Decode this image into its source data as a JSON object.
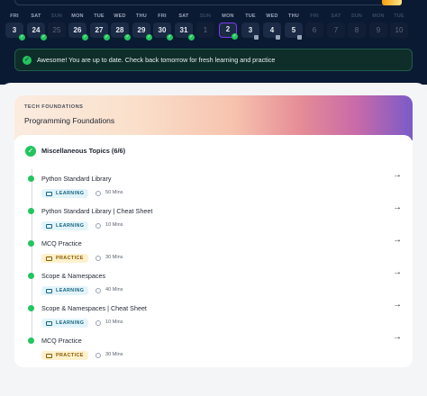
{
  "days": [
    {
      "name": "FRI",
      "num": "3",
      "state": "done"
    },
    {
      "name": "SAT",
      "num": "24",
      "state": "done"
    },
    {
      "name": "SUN",
      "num": "25",
      "state": "weekend"
    },
    {
      "name": "MON",
      "num": "26",
      "state": "done"
    },
    {
      "name": "TUE",
      "num": "27",
      "state": "done"
    },
    {
      "name": "WED",
      "num": "28",
      "state": "done"
    },
    {
      "name": "THU",
      "num": "29",
      "state": "done"
    },
    {
      "name": "FRI",
      "num": "30",
      "state": "done"
    },
    {
      "name": "SAT",
      "num": "31",
      "state": "done"
    },
    {
      "name": "SUN",
      "num": "1",
      "state": "weekend"
    },
    {
      "name": "MON",
      "num": "2",
      "state": "today"
    },
    {
      "name": "TUE",
      "num": "3",
      "state": "locked"
    },
    {
      "name": "WED",
      "num": "4",
      "state": "locked"
    },
    {
      "name": "THU",
      "num": "5",
      "state": "locked"
    },
    {
      "name": "FRI",
      "num": "6",
      "state": "future"
    },
    {
      "name": "SAT",
      "num": "7",
      "state": "future"
    },
    {
      "name": "SUN",
      "num": "8",
      "state": "future"
    },
    {
      "name": "MON",
      "num": "9",
      "state": "future"
    },
    {
      "name": "TUE",
      "num": "10",
      "state": "future"
    }
  ],
  "banner": {
    "check": "✓",
    "message": "Awesome! You are up to date. Check back tomorrow for fresh learning and practice"
  },
  "card": {
    "category": "TECH FOUNDATIONS",
    "title": "Programming Foundations",
    "section": {
      "check": "✓",
      "title": "Miscellaneous Topics (6/6)"
    },
    "items": [
      {
        "name": "Python Standard Library",
        "type": "LEARNING",
        "duration": "50 Mins"
      },
      {
        "name": "Python Standard Library | Cheat Sheet",
        "type": "LEARNING",
        "duration": "10 Mins"
      },
      {
        "name": "MCQ Practice",
        "type": "PRACTICE",
        "duration": "30 Mins"
      },
      {
        "name": "Scope & Namespaces",
        "type": "LEARNING",
        "duration": "40 Mins"
      },
      {
        "name": "Scope & Namespaces | Cheat Sheet",
        "type": "LEARNING",
        "duration": "10 Mins"
      },
      {
        "name": "MCQ Practice",
        "type": "PRACTICE",
        "duration": "30 Mins"
      }
    ],
    "arrow": "→"
  },
  "colors": {
    "top_bg": "#0b1a33",
    "success": "#22c55e",
    "today_border": "#7c3aed"
  }
}
